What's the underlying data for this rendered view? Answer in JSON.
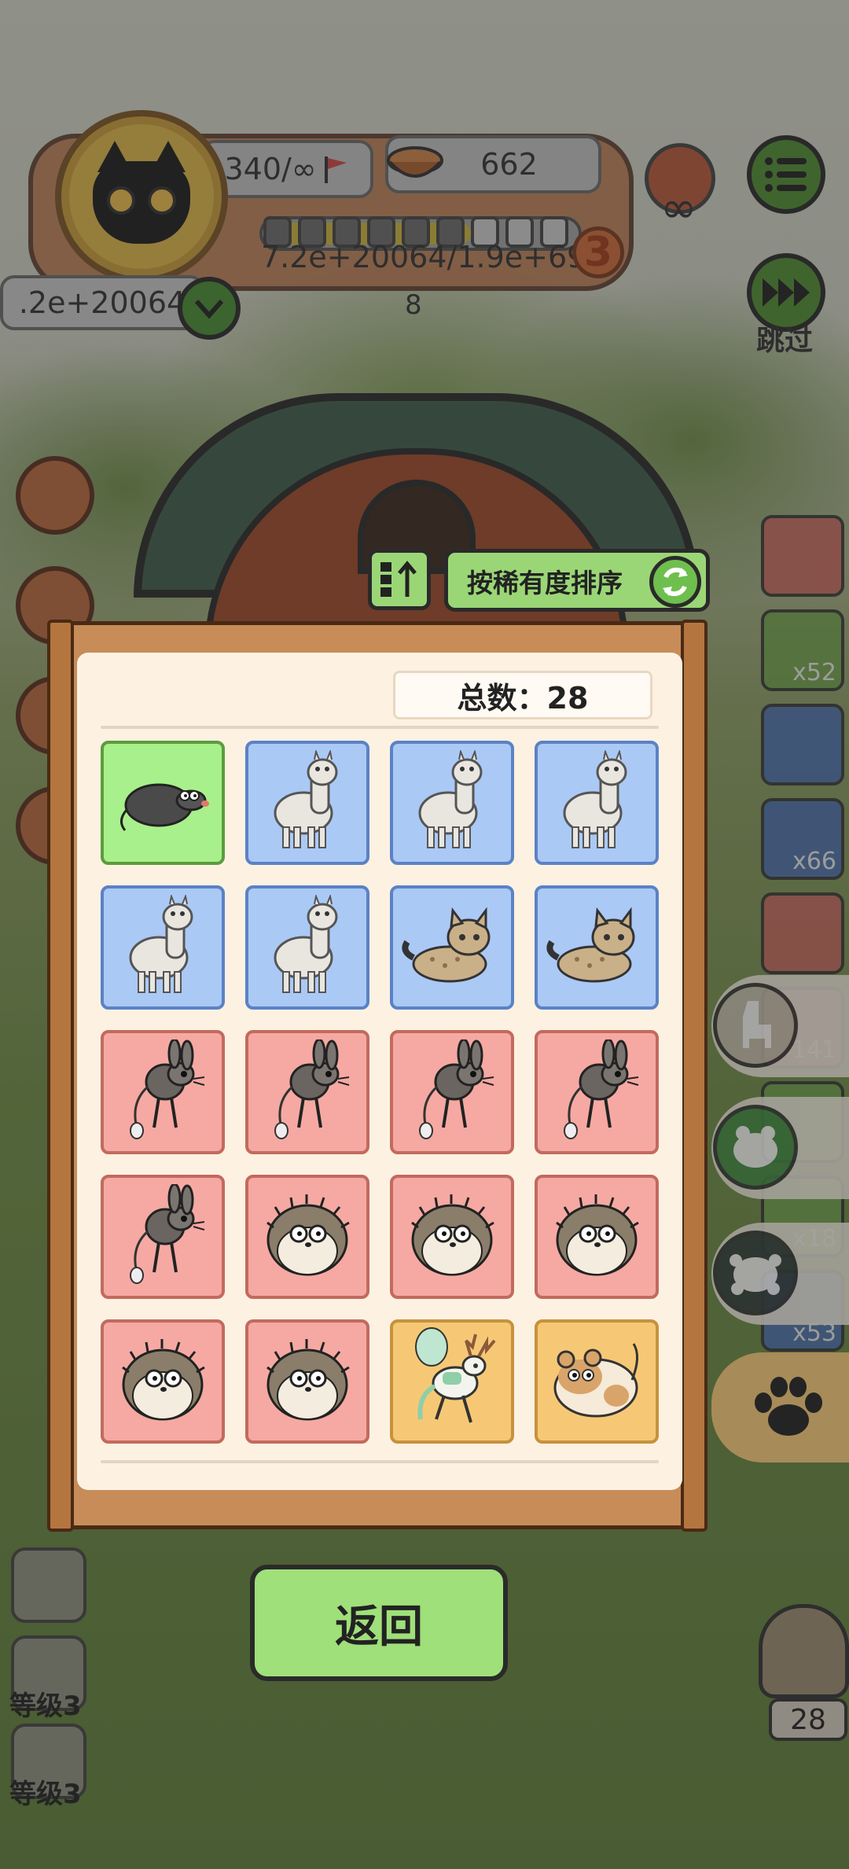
{
  "hud": {
    "energy": "340/∞",
    "food_count": "662",
    "progress_text": "7.2e+20064/1.9e+69",
    "level_badge": "3",
    "sub_count": "8",
    "coins": ".2e+20064",
    "infinity": "∞",
    "skip_label": "跳过"
  },
  "right_items": {
    "counts": [
      "x52",
      "x66",
      "141",
      "x18",
      "x53"
    ]
  },
  "collection": {
    "sort_label": "按稀有度排序",
    "total_label": "总数：28",
    "cards": [
      {
        "animal": "mole",
        "rarity": "green"
      },
      {
        "animal": "alpaca",
        "rarity": "blue"
      },
      {
        "animal": "alpaca",
        "rarity": "blue"
      },
      {
        "animal": "alpaca",
        "rarity": "blue"
      },
      {
        "animal": "alpaca",
        "rarity": "blue"
      },
      {
        "animal": "alpaca",
        "rarity": "blue"
      },
      {
        "animal": "sand-cat",
        "rarity": "blue"
      },
      {
        "animal": "sand-cat",
        "rarity": "blue"
      },
      {
        "animal": "jerboa",
        "rarity": "red"
      },
      {
        "animal": "jerboa",
        "rarity": "red"
      },
      {
        "animal": "jerboa",
        "rarity": "red"
      },
      {
        "animal": "jerboa",
        "rarity": "red"
      },
      {
        "animal": "jerboa",
        "rarity": "red"
      },
      {
        "animal": "hedgehog",
        "rarity": "red"
      },
      {
        "animal": "hedgehog",
        "rarity": "red"
      },
      {
        "animal": "hedgehog",
        "rarity": "red"
      },
      {
        "animal": "hedgehog",
        "rarity": "red"
      },
      {
        "animal": "hedgehog",
        "rarity": "red"
      },
      {
        "animal": "deer-spirit",
        "rarity": "gold"
      },
      {
        "animal": "hamster",
        "rarity": "gold"
      }
    ],
    "return_label": "返回"
  },
  "level_buttons": {
    "label_1": "等级3",
    "label_2": "等级3"
  },
  "owl_count": "28",
  "colors": {
    "green_rarity": "#a8f08c",
    "blue_rarity": "#abc9f5",
    "red_rarity": "#f5a9a2",
    "gold_rarity": "#f6c876",
    "button_green": "#9fe07a"
  }
}
